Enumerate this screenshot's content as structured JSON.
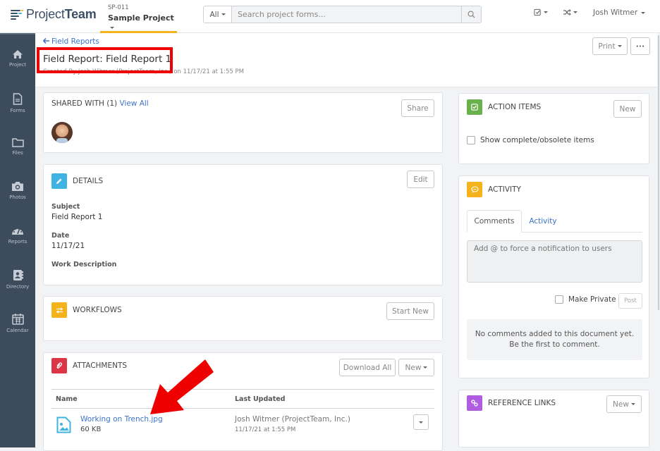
{
  "topbar": {
    "logo_light": "Project",
    "logo_bold": "Team",
    "project_code": "SP-011",
    "project_name": "Sample Project",
    "search_scope": "All",
    "search_placeholder": "Search project forms...",
    "user_name": "Josh Witmer"
  },
  "sidebar": {
    "items": [
      {
        "label": "Project",
        "icon": "home-icon"
      },
      {
        "label": "Forms",
        "icon": "document-icon"
      },
      {
        "label": "Files",
        "icon": "folder-icon"
      },
      {
        "label": "Photos",
        "icon": "camera-icon"
      },
      {
        "label": "Reports",
        "icon": "dashboard-icon"
      },
      {
        "label": "Directory",
        "icon": "address-book-icon"
      },
      {
        "label": "Calendar",
        "icon": "calendar-icon"
      }
    ]
  },
  "header": {
    "back_label": "Field Reports",
    "title": "Field Report: Field Report 1",
    "subtitle": "Created By Josh Witmer (ProjectTeam, Inc.) on 11/17/21 at 1:55 PM",
    "print_label": "Print",
    "more_label": "•••"
  },
  "shared": {
    "title": "SHARED WITH (1)",
    "view_all": "View All",
    "share_label": "Share"
  },
  "details": {
    "title": "DETAILS",
    "edit_label": "Edit",
    "fields": [
      {
        "label": "Subject",
        "value": "Field Report 1"
      },
      {
        "label": "Date",
        "value": "11/17/21"
      },
      {
        "label": "Work Description",
        "value": ""
      }
    ]
  },
  "workflows": {
    "title": "WORKFLOWS",
    "start_label": "Start New"
  },
  "attachments": {
    "title": "ATTACHMENTS",
    "download_all_label": "Download All",
    "new_label": "New",
    "columns": [
      "Name",
      "Last Updated"
    ],
    "rows": [
      {
        "name": "Working on Trench.jpg",
        "size": "60 KB",
        "updated_by": "Josh Witmer (ProjectTeam, Inc.)",
        "updated_at": "11/17/21 at 1:55 PM"
      }
    ]
  },
  "action_items": {
    "title": "ACTION ITEMS",
    "new_label": "New",
    "show_complete_label": "Show complete/obsolete items"
  },
  "activity": {
    "title": "ACTIVITY",
    "tabs": [
      "Comments",
      "Activity"
    ],
    "comment_placeholder": "Add @ to force a notification to users",
    "make_private_label": "Make Private",
    "post_label": "Post",
    "empty_line1": "No comments added to this document yet.",
    "empty_line2": "Be the first to comment."
  },
  "reference_links": {
    "title": "REFERENCE LINKS",
    "new_label": "New"
  },
  "colors": {
    "accent_blue": "#3b73c9",
    "sidebar_bg": "#3d4c5c",
    "project_underline": "#f4b21e",
    "details_icon": "#3fb4e3",
    "workflows_icon": "#f6b21a",
    "attachments_icon": "#dc3545",
    "action_items_icon": "#6ab04c",
    "activity_icon": "#f6b21a",
    "reference_links_icon": "#b05ce0",
    "annotation_red": "#ee0000"
  }
}
